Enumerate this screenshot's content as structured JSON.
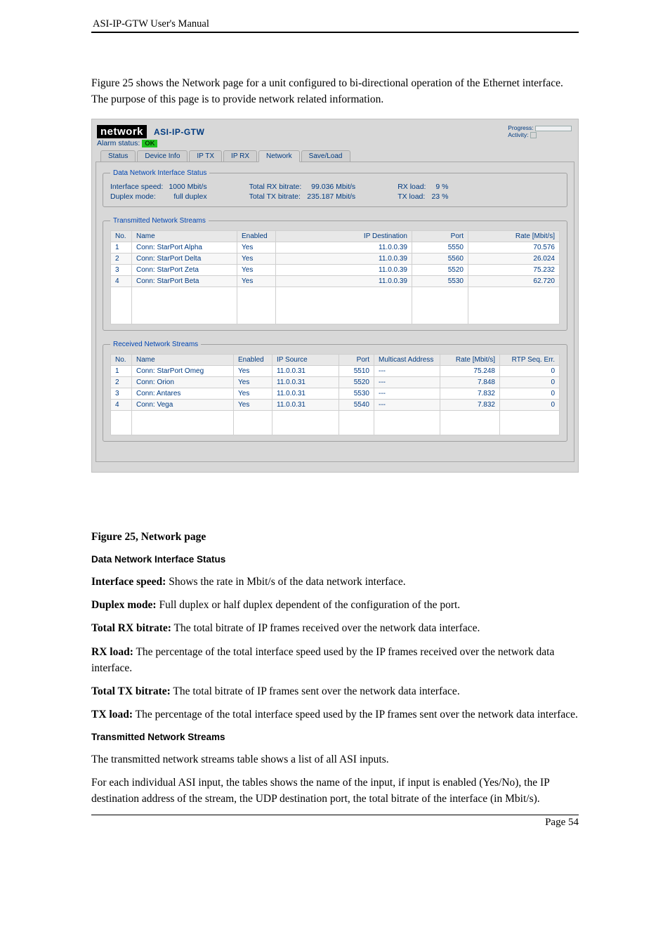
{
  "doc": {
    "header": "ASI-IP-GTW User's Manual",
    "intro": "Figure 25 shows the Network page for a unit configured to bi-directional operation of the Ethernet interface. The purpose of this page is to provide network related information.",
    "footer": "Page 54"
  },
  "app": {
    "logo": "network",
    "model": "ASI-IP-GTW",
    "progress_label": "Progress:",
    "activity_label": "Activity:",
    "alarm_label": "Alarm status:",
    "alarm_value": "OK",
    "tabs": [
      "Status",
      "Device Info",
      "IP TX",
      "IP RX",
      "Network",
      "Save/Load"
    ],
    "active_tab": "Network"
  },
  "status": {
    "title": "Data Network Interface Status",
    "interface_speed_label": "Interface speed:",
    "interface_speed_value": "1000 Mbit/s",
    "duplex_label": "Duplex mode:",
    "duplex_value": "full duplex",
    "rx_bitrate_label": "Total RX bitrate:",
    "rx_bitrate_value": "99.036 Mbit/s",
    "tx_bitrate_label": "Total TX bitrate:",
    "tx_bitrate_value": "235.187 Mbit/s",
    "rx_load_label": "RX load:",
    "rx_load_value": "9 %",
    "tx_load_label": "TX load:",
    "tx_load_value": "23 %"
  },
  "tx": {
    "title": "Transmitted Network Streams",
    "cols": [
      "No.",
      "Name",
      "Enabled",
      "IP Destination",
      "Port",
      "Rate [Mbit/s]"
    ],
    "rows": [
      {
        "no": "1",
        "name": "Conn: StarPort Alpha",
        "en": "Yes",
        "dest": "11.0.0.39",
        "port": "5550",
        "rate": "70.576"
      },
      {
        "no": "2",
        "name": "Conn: StarPort Delta",
        "en": "Yes",
        "dest": "11.0.0.39",
        "port": "5560",
        "rate": "26.024"
      },
      {
        "no": "3",
        "name": "Conn: StarPort Zeta",
        "en": "Yes",
        "dest": "11.0.0.39",
        "port": "5520",
        "rate": "75.232"
      },
      {
        "no": "4",
        "name": "Conn: StarPort Beta",
        "en": "Yes",
        "dest": "11.0.0.39",
        "port": "5530",
        "rate": "62.720"
      }
    ]
  },
  "rx": {
    "title": "Received Network Streams",
    "cols": [
      "No.",
      "Name",
      "Enabled",
      "IP Source",
      "Port",
      "Multicast Address",
      "Rate [Mbit/s]",
      "RTP Seq. Err."
    ],
    "rows": [
      {
        "no": "1",
        "name": "Conn: StarPort Omeg",
        "en": "Yes",
        "src": "11.0.0.31",
        "port": "5510",
        "mc": "---",
        "rate": "75.248",
        "err": "0"
      },
      {
        "no": "2",
        "name": "Conn: Orion",
        "en": "Yes",
        "src": "11.0.0.31",
        "port": "5520",
        "mc": "---",
        "rate": "7.848",
        "err": "0"
      },
      {
        "no": "3",
        "name": "Conn: Antares",
        "en": "Yes",
        "src": "11.0.0.31",
        "port": "5530",
        "mc": "---",
        "rate": "7.832",
        "err": "0"
      },
      {
        "no": "4",
        "name": "Conn: Vega",
        "en": "Yes",
        "src": "11.0.0.31",
        "port": "5540",
        "mc": "---",
        "rate": "7.832",
        "err": "0"
      }
    ]
  },
  "desc": {
    "figcap": "Figure 25, Network page",
    "h_status": "Data Network Interface Status",
    "p1_l": "Interface speed:",
    "p1": " Shows the rate in Mbit/s of the data network interface.",
    "p2_l": "Duplex mode:",
    "p2": " Full duplex or half duplex dependent of the configuration of the port.",
    "p3_l": "Total RX bitrate:",
    "p3": " The total bitrate of IP frames received over the network data interface.",
    "p4_l": "RX load:",
    "p4": " The percentage of the total interface speed used by the IP frames received over the network data interface.",
    "p5_l": "Total TX bitrate:",
    "p5": " The total bitrate of IP frames sent over the network data interface.",
    "p6_l": "TX load:",
    "p6": " The percentage of the total interface speed used by the IP frames sent over the network data interface.",
    "h_tx": "Transmitted Network Streams",
    "tx_p1": "The transmitted network streams table shows a list of all ASI inputs.",
    "tx_p2": "For each individual ASI input, the tables shows the name of the input, if input is enabled (Yes/No), the IP destination address of the stream, the UDP destination port, the total bitrate of the interface (in Mbit/s)."
  }
}
